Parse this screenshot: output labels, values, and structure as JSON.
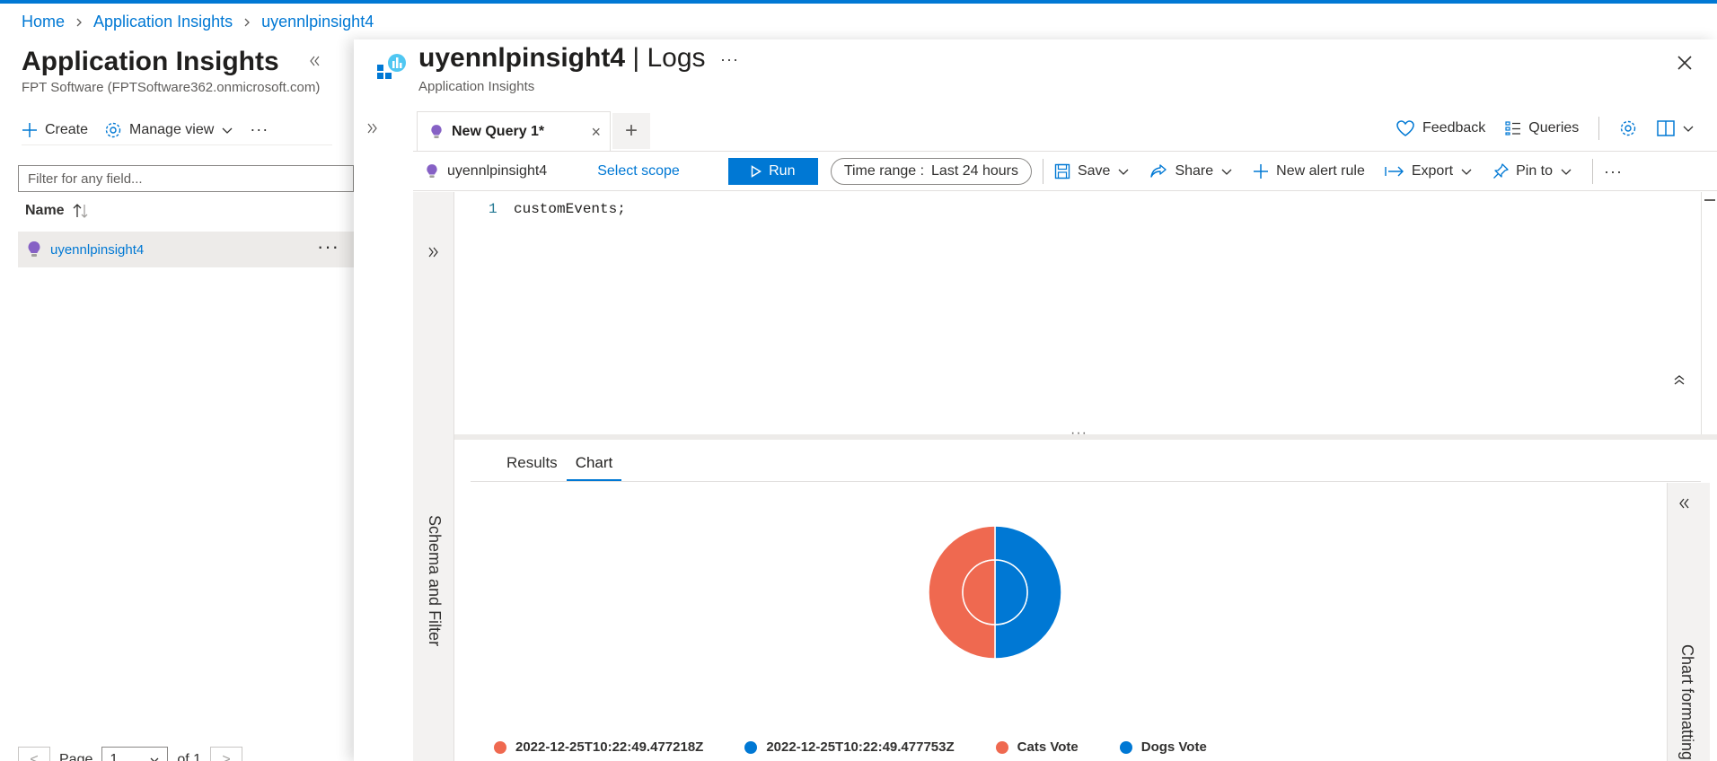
{
  "breadcrumb": [
    "Home",
    "Application Insights",
    "uyennlpinsight4"
  ],
  "left": {
    "title": "Application Insights",
    "subtitle": "FPT Software (FPTSoftware362.onmicrosoft.com)",
    "create_label": "Create",
    "manage_view_label": "Manage view",
    "filter_placeholder": "Filter for any field...",
    "column_name": "Name",
    "row_name": "uyennlpinsight4",
    "pager": {
      "page_label": "Page",
      "page_value": "1",
      "of_label": "of 1"
    }
  },
  "right": {
    "title_resource": "uyennlpinsight4",
    "title_suffix": " | Logs",
    "subtitle": "Application Insights",
    "tab_label": "New Query 1*",
    "tools": {
      "feedback": "Feedback",
      "queries": "Queries"
    },
    "toolbar": {
      "scope_name": "uyennlpinsight4",
      "select_scope": "Select scope",
      "run": "Run",
      "time_range_label": "Time range :",
      "time_range_value": "Last 24 hours",
      "save": "Save",
      "share": "Share",
      "new_alert_rule": "New alert rule",
      "export": "Export",
      "pin_to": "Pin to"
    },
    "editor": {
      "line_number": "1",
      "code": "customEvents;"
    },
    "schema_label": "Schema and Filter",
    "results_tabs": [
      "Results",
      "Chart"
    ],
    "active_results_tab": "Chart",
    "chart_formatting_label": "Chart formatting"
  },
  "colors": {
    "accent": "#0078d4",
    "orange": "#ef6950",
    "blue": "#0078d4"
  },
  "chart_data": {
    "type": "pie",
    "series": [
      {
        "name": "2022-12-25T10:22:49.477218Z",
        "ring": "inner",
        "values": [
          1
        ]
      },
      {
        "name": "2022-12-25T10:22:49.477753Z",
        "ring": "inner",
        "values": [
          1
        ]
      },
      {
        "name": "Cats Vote",
        "ring": "outer",
        "values": [
          1
        ]
      },
      {
        "name": "Dogs Vote",
        "ring": "outer",
        "values": [
          1
        ]
      }
    ],
    "legend": [
      "2022-12-25T10:22:49.477218Z",
      "2022-12-25T10:22:49.477753Z",
      "Cats Vote",
      "Dogs Vote"
    ],
    "legend_colors": [
      "#ef6950",
      "#0078d4",
      "#ef6950",
      "#0078d4"
    ],
    "legend_position": "bottom"
  }
}
